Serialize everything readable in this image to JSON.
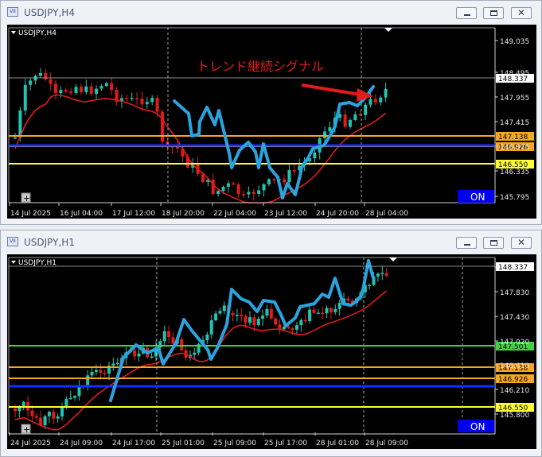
{
  "windows": [
    {
      "id": "h4",
      "title": "USDJPY,H4",
      "symbol_label": "USDJPY,H4",
      "annotation": "トレンド継続シグナル",
      "on_button": "ON",
      "price_ticks": [
        "149.035",
        "148.495",
        "147.955",
        "147.415",
        "146.875",
        "146.335",
        "145.795"
      ],
      "current_price": "148.337",
      "levels": [
        {
          "label": "147.138",
          "color": "#f5a623"
        },
        {
          "label": "146.926",
          "color": "#f5a623"
        },
        {
          "label": "146.550",
          "color": "#ffff33"
        }
      ],
      "time_labels": [
        "14 Jul 2025",
        "16 Jul 04:00",
        "17 Jul 12:00",
        "18 Jul 20:00",
        "22 Jul 04:00",
        "23 Jul 12:00",
        "24 Jul 20:00",
        "28 Jul 04:00"
      ]
    },
    {
      "id": "h1",
      "title": "USDJPY,H1",
      "symbol_label": "USDJPY,H1",
      "on_button": "ON",
      "price_ticks": [
        "148.240",
        "147.830",
        "147.430",
        "147.020",
        "146.610",
        "146.210",
        "145.800"
      ],
      "current_price": "148.337",
      "levels": [
        {
          "label": "147.501",
          "color": "#3fd43f"
        },
        {
          "label": "147.138",
          "color": "#f5a623"
        },
        {
          "label": "146.926",
          "color": "#f5a623"
        },
        {
          "label": "146.550",
          "color": "#ffff33"
        }
      ],
      "time_labels": [
        "24 Jul 2025",
        "24 Jul 09:00",
        "24 Jul 17:00",
        "25 Jul 01:00",
        "25 Jul 09:00",
        "25 Jul 17:00",
        "28 Jul 01:00",
        "28 Jul 09:00"
      ]
    }
  ],
  "colors": {
    "bull": "#22c3b0",
    "bear": "#e21b1b",
    "ma": "#e21b1b",
    "trace": "#2a9fd8",
    "on_bg": "#0000ee",
    "annotation": "#e21b1b",
    "blue_line": "#1030ff"
  }
}
